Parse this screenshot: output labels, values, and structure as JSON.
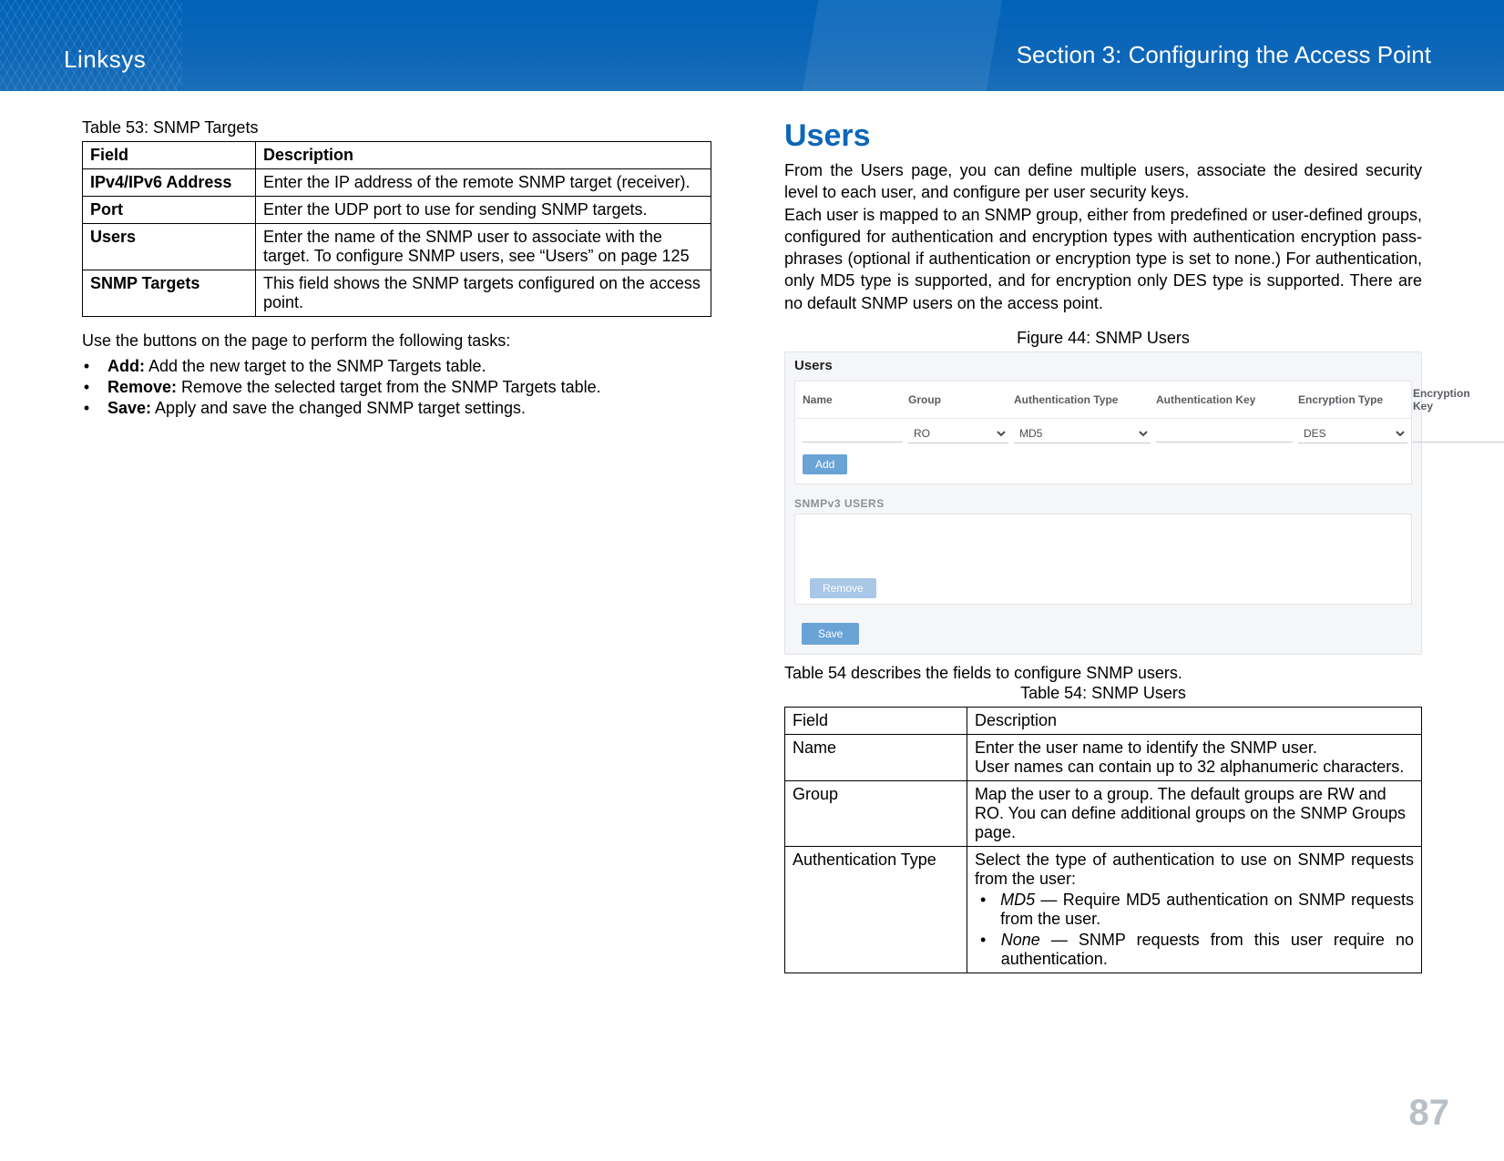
{
  "header": {
    "brand": "Linksys",
    "section": "Section 3:  Configuring the Access Point"
  },
  "left": {
    "table53": {
      "caption": "Table 53: SNMP Targets",
      "headers": {
        "field": "Field",
        "desc": "Description"
      },
      "rows": [
        {
          "field": "IPv4/IPv6 Address",
          "desc": "Enter the IP address of the remote SNMP target (receiver)."
        },
        {
          "field": "Port",
          "desc": "Enter the UDP port to use for sending SNMP targets."
        },
        {
          "field": "Users",
          "desc": "Enter the name of the SNMP user to associate with the target. To configure SNMP users, see “Users” on page 125"
        },
        {
          "field": "SNMP Targets",
          "desc": "This field shows the SNMP targets configured on the access point."
        }
      ]
    },
    "tasks_intro": "Use the buttons on the page to perform the following tasks:",
    "tasks": [
      {
        "term": "Add:",
        "text": " Add the new target to the SNMP Targets table."
      },
      {
        "term": "Remove:",
        "text": " Remove the selected target from the SNMP Targets table."
      },
      {
        "term": "Save:",
        "text": " Apply and save the changed SNMP target settings."
      }
    ]
  },
  "right": {
    "heading": "Users",
    "intro1": "From the Users page, you can define multiple users, associate the desired security level to each user, and configure per user security keys.",
    "intro2": "Each user is mapped to an SNMP group, either from predefined or user-defined groups, configured for authentication and encryption types with authentication encryption pass-phrases (optional if authentication or encryption type is set to none.) For authentication, only MD5 type is supported, and for encryption only DES type is supported. There are no default SNMP users on the access point.",
    "figure": {
      "caption": "Figure 44: SNMP Users",
      "panel_title": "Users",
      "cols": {
        "name": "Name",
        "group": "Group",
        "auth_type": "Authentication Type",
        "auth_key": "Authentication Key",
        "enc_type": "Encryption Type",
        "enc_key": "Encryption Key"
      },
      "row": {
        "group_value": "RO",
        "auth_type_value": "MD5",
        "enc_type_value": "DES"
      },
      "add_label": "Add",
      "subhead": "SNMPv3 USERS",
      "remove_label": "Remove",
      "save_label": "Save"
    },
    "table54_intro": "Table 54 describes the fields to configure SNMP users.",
    "table54": {
      "caption": "Table 54: SNMP Users",
      "headers": {
        "field": "Field",
        "desc": "Description"
      },
      "rows": {
        "name": {
          "field": "Name",
          "line1": "Enter the user name to identify the SNMP user.",
          "line2": "User names can contain up to 32 alphanumeric characters."
        },
        "group": {
          "field": "Group",
          "desc": "Map the user to a group. The default groups are RW and RO. You can define additional groups on the SNMP Groups page."
        },
        "auth": {
          "field": "Authentication Type",
          "lead": "Select the type of authentication to use on SNMP requests from the user:",
          "md5_term": "MD5",
          "md5_text": " — Require MD5 authentication on SNMP requests from the user.",
          "none_term": "None",
          "none_text": " — SNMP requests from this user require no authentication."
        }
      }
    }
  },
  "page_number": "87"
}
